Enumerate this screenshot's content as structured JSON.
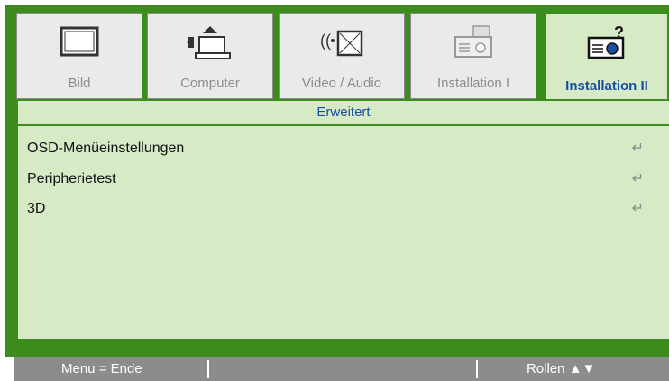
{
  "tabs": [
    {
      "label": "Bild",
      "icon": "monitor-icon",
      "active": false
    },
    {
      "label": "Computer",
      "icon": "computer-icon",
      "active": false
    },
    {
      "label": "Video / Audio",
      "icon": "video-audio-icon",
      "active": false
    },
    {
      "label": "Installation I",
      "icon": "projector-settings-icon",
      "active": false
    },
    {
      "label": "Installation II",
      "icon": "projector-help-icon",
      "active": true
    }
  ],
  "section": {
    "title": "Erweitert"
  },
  "menu_items": [
    {
      "label": "OSD-Menüeinstellungen",
      "icon": "enter-icon"
    },
    {
      "label": "Peripherietest",
      "icon": "enter-icon"
    },
    {
      "label": "3D",
      "icon": "enter-icon"
    }
  ],
  "footer": {
    "left": "Menu = Ende",
    "right": "Rollen ▲▼"
  },
  "colors": {
    "accent_green": "#3c8d1e",
    "panel_bg": "#d6ebc5",
    "active_text": "#1a4fa0",
    "tab_bg": "#eaeaea",
    "footer_bg": "#8c8c8c"
  }
}
